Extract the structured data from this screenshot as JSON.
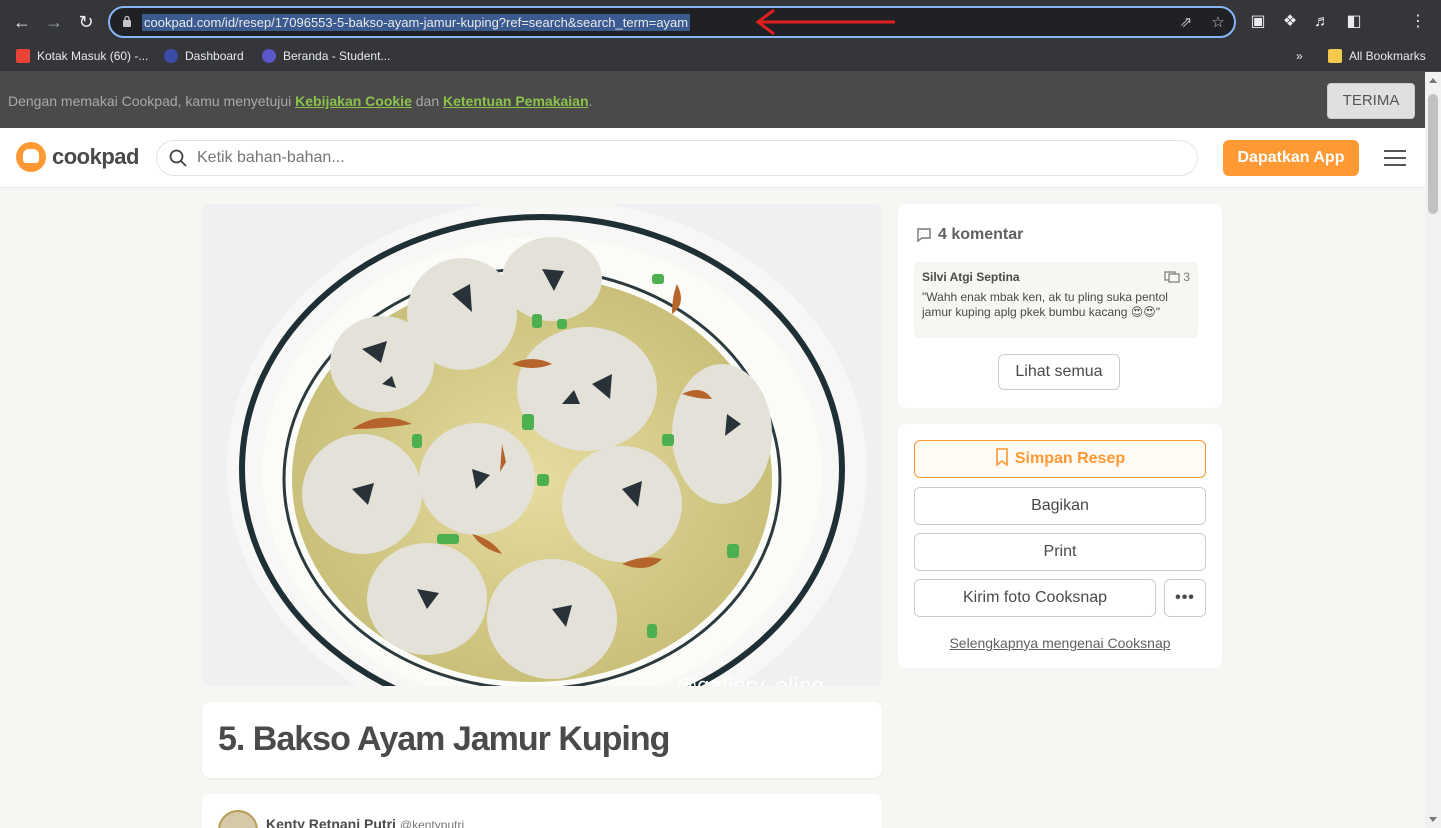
{
  "browser": {
    "url": "cookpad.com/id/resep/17096553-5-bakso-ayam-jamur-kuping?ref=search&search_term=ayam",
    "bookmarks": [
      {
        "label": "Kotak Masuk (60) -..."
      },
      {
        "label": "Dashboard"
      },
      {
        "label": "Beranda - Student..."
      }
    ],
    "overflow_label": "»",
    "all_bookmarks_label": "All Bookmarks"
  },
  "cookie_bar": {
    "prefix": "Dengan memakai Cookpad, kamu menyetujui ",
    "cookie_link": "Kebijakan Cookie",
    "middle": " dan ",
    "terms_link": "Ketentuan Pemakaian",
    "suffix": ".",
    "accept_label": "TERIMA"
  },
  "header": {
    "logo_text": "cookpad",
    "search_placeholder": "Ketik bahan-bahan...",
    "get_app_label": "Dapatkan App",
    "brand_color": "#ff9933"
  },
  "recipe": {
    "title": "5. Bakso Ayam Jamur Kuping",
    "image_watermark": "@gallery_eling",
    "author_name": "Kenty Retnani Putri",
    "author_handle": "@kentyputri"
  },
  "comments": {
    "heading": "4 komentar",
    "first": {
      "user": "Silvi Atgi Septina",
      "reply_count": "3",
      "text": "\"Wahh enak mbak ken, ak tu pling suka pentol jamur kuping aplg pkek bumbu kacang 😍😍\""
    },
    "see_all_label": "Lihat semua"
  },
  "actions": {
    "save_label": "Simpan Resep",
    "share_label": "Bagikan",
    "print_label": "Print",
    "cooksnap_label": "Kirim foto Cooksnap",
    "more_label": "•••",
    "more_link": "Selengkapnya mengenai Cooksnap"
  }
}
